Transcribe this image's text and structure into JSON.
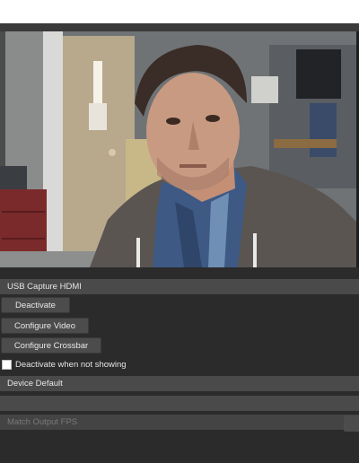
{
  "source": {
    "name": "USB Capture HDMI"
  },
  "buttons": {
    "deactivate": "Deactivate",
    "configure_video": "Configure Video",
    "configure_crossbar": "Configure Crossbar"
  },
  "checkbox": {
    "label": "Deactivate when not showing",
    "checked": false
  },
  "audio": {
    "device": "Device Default"
  },
  "fields": {
    "blank": "",
    "fps": "Match Output FPS"
  },
  "colors": {
    "panel_bg": "#2b2b2b",
    "field_bg": "#4a4a4a",
    "text": "#e6e6e6",
    "disabled_text": "#7a7a7a"
  }
}
